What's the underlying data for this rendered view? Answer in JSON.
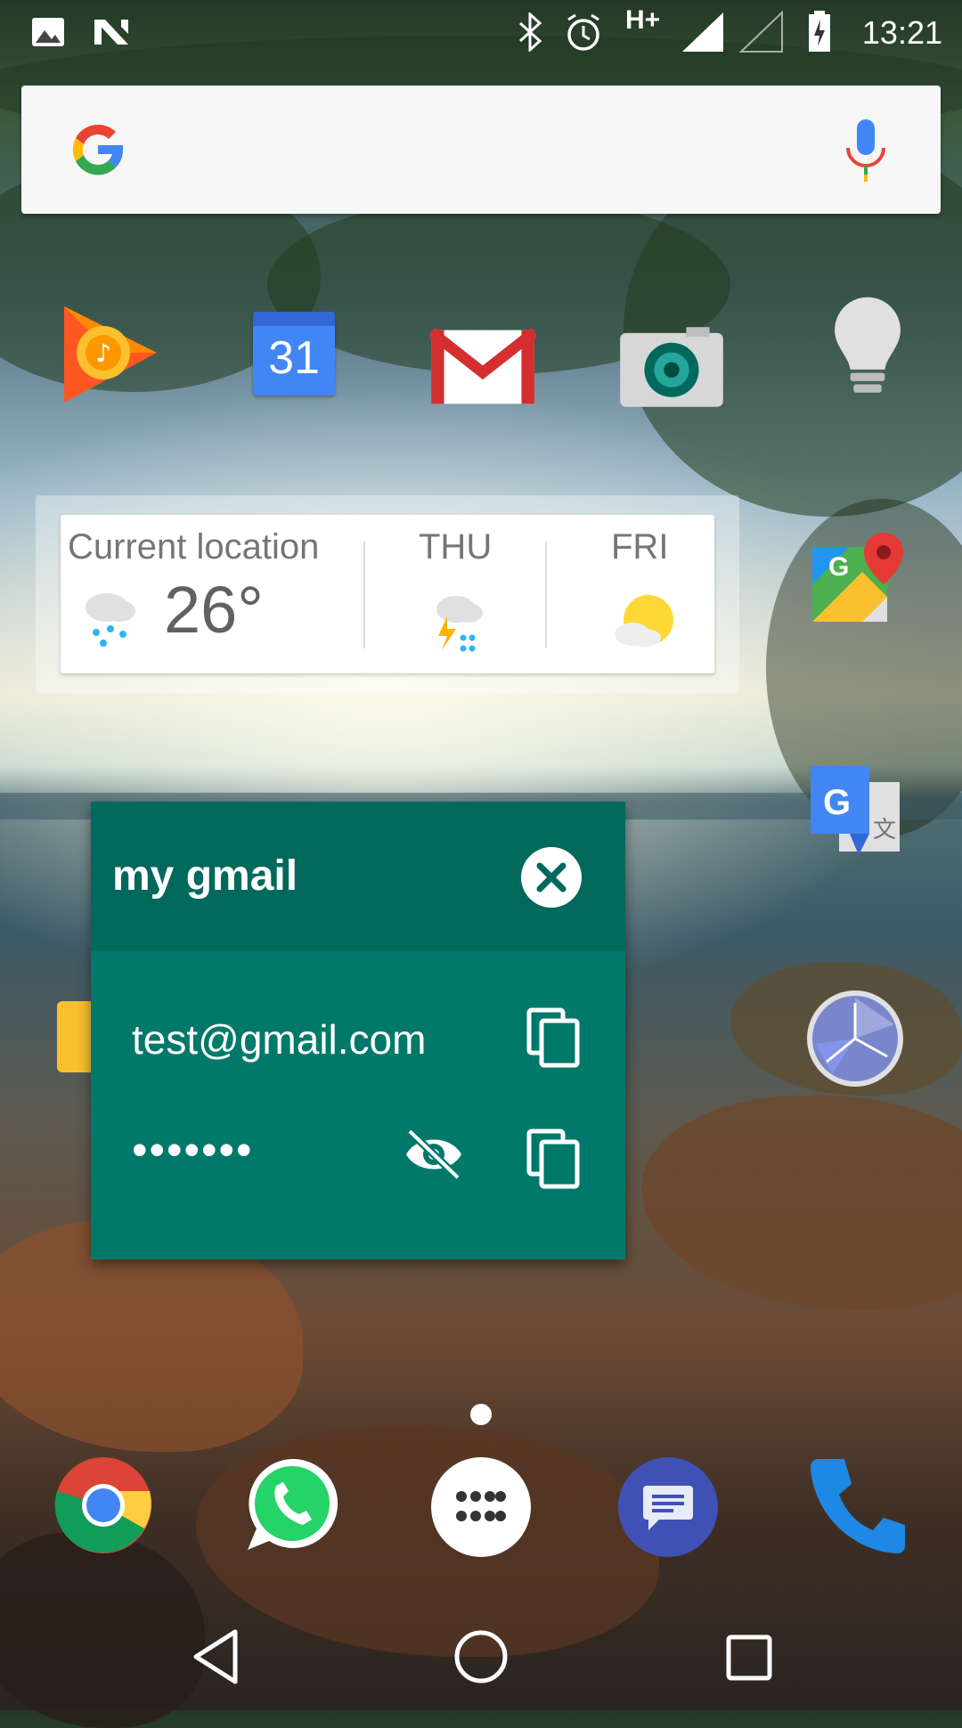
{
  "status_bar": {
    "time": "13:21",
    "network": "H+"
  },
  "search": {
    "provider_icon": "google-g-icon",
    "voice_icon": "mic-icon"
  },
  "home_apps": [
    {
      "name": "Play Music",
      "icon": "play-music-icon"
    },
    {
      "name": "Calendar",
      "icon": "calendar-icon",
      "label": "31"
    },
    {
      "name": "Gmail",
      "icon": "gmail-icon"
    },
    {
      "name": "Camera",
      "icon": "camera-icon"
    },
    {
      "name": "Keep",
      "icon": "lightbulb-icon"
    }
  ],
  "weather": {
    "location_label": "Current location",
    "temperature": "26°",
    "days": [
      {
        "label": "THU",
        "icon": "thunderstorm-icon"
      },
      {
        "label": "FRI",
        "icon": "partly-sunny-icon"
      }
    ]
  },
  "side_apps": [
    {
      "name": "Maps",
      "icon": "maps-icon"
    },
    {
      "name": "Translate",
      "icon": "translate-icon"
    },
    {
      "name": "Clock",
      "icon": "clock-icon"
    }
  ],
  "popup": {
    "title": "my gmail",
    "email": "test@gmail.com",
    "password_masked": "•••••••",
    "colors": {
      "header": "#00695c",
      "body": "#00796b"
    }
  },
  "dock": [
    {
      "name": "Chrome",
      "icon": "chrome-icon"
    },
    {
      "name": "WhatsApp",
      "icon": "whatsapp-icon"
    },
    {
      "name": "App drawer",
      "icon": "app-drawer-icon"
    },
    {
      "name": "Messages",
      "icon": "messages-icon"
    },
    {
      "name": "Phone",
      "icon": "phone-icon"
    }
  ]
}
